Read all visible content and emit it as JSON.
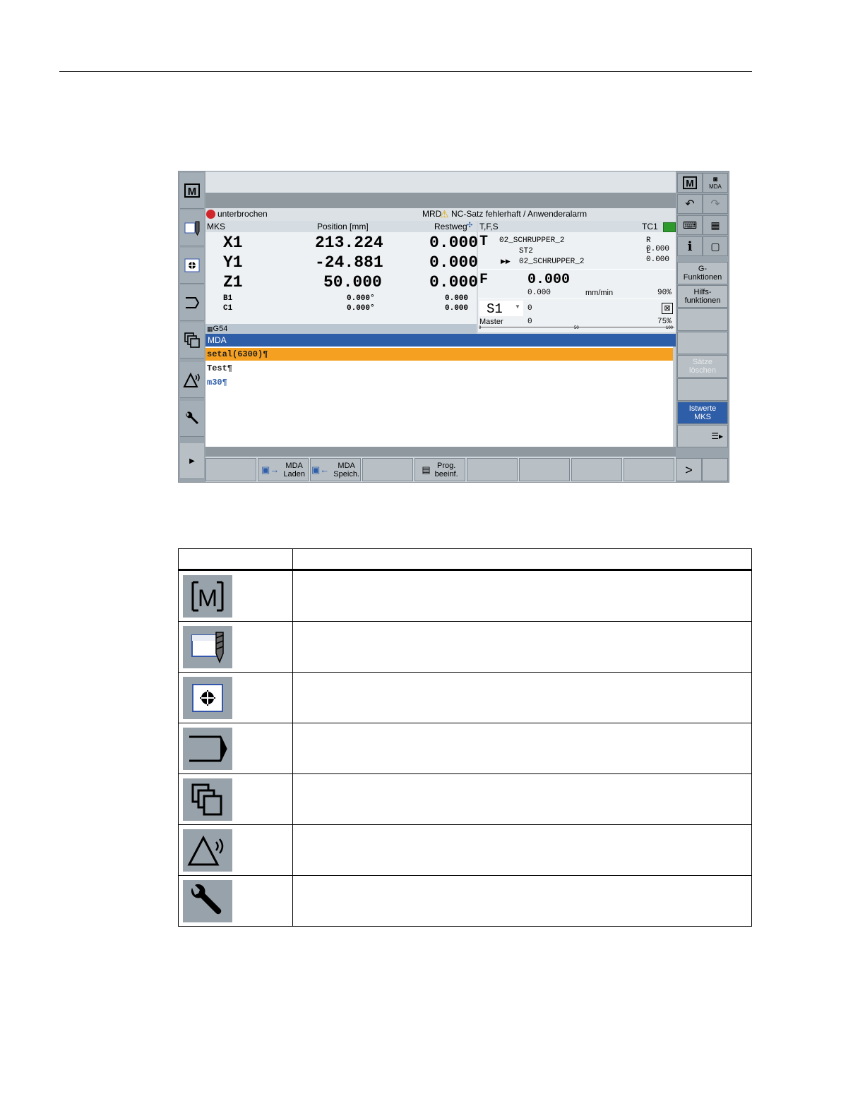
{
  "screen": {
    "alarm": {
      "left": "unterbrochen",
      "center": "MRD",
      "right": "NC-Satz fehlerhaft / Anwenderalarm"
    },
    "mks": {
      "title": "MKS",
      "col_position": "Position [mm]",
      "col_restweg": "Restweg",
      "axes": [
        {
          "name": "X1",
          "pos": "213.224",
          "rest": "0.000"
        },
        {
          "name": "Y1",
          "pos": "-24.881",
          "rest": "0.000"
        },
        {
          "name": "Z1",
          "pos": "50.000",
          "rest": "0.000"
        }
      ],
      "small_axes": [
        {
          "name": "B1",
          "pos": "0.000°",
          "rest": "0.000"
        },
        {
          "name": "C1",
          "pos": "0.000°",
          "rest": "0.000"
        }
      ],
      "frame": "G54"
    },
    "tfs": {
      "title": "T,F,S",
      "tc": "TC1",
      "t_label": "T",
      "tool": "02_SCHRUPPER_2",
      "station": "ST2",
      "next_tool": "02_SCHRUPPER_2",
      "r": "R 0.000",
      "l": "L 0.000",
      "f_label": "F",
      "f_value": "0.000",
      "f_sub": "0.000",
      "f_unit": "mm/min",
      "f_pct": "90%",
      "s_label": "S1",
      "s_value": "0",
      "s_master": "Master",
      "s_master_value": "0",
      "s_pct": "75%",
      "scale": [
        "0",
        "50",
        "100"
      ]
    },
    "editor": {
      "title": "MDA",
      "lines": [
        "setal(6300)¶",
        "Test¶",
        "m30¶"
      ]
    },
    "vertical_softkeys": [
      "G-\nFunktionen",
      "Hilfs-\nfunktionen",
      "",
      "",
      "Sätze\nlöschen",
      "",
      "Istwerte\nMKS"
    ],
    "top_right": {
      "mda_label": "MDA",
      "m_label": "M"
    },
    "horizontal_softkeys": [
      "",
      "MDA\nLaden",
      "MDA\nSpeich.",
      "",
      "Prog.\nbeeinf.",
      "",
      "",
      "",
      "",
      ">"
    ]
  },
  "legend_rows": [
    {
      "icon": "machine-icon",
      "description": ""
    },
    {
      "icon": "parameter-icon",
      "description": ""
    },
    {
      "icon": "program-icon",
      "description": ""
    },
    {
      "icon": "program-manager-icon",
      "description": ""
    },
    {
      "icon": "diagnostics-icon",
      "description": ""
    },
    {
      "icon": "commissioning-icon",
      "description": ""
    },
    {
      "icon": "wrench-icon",
      "description": ""
    }
  ]
}
